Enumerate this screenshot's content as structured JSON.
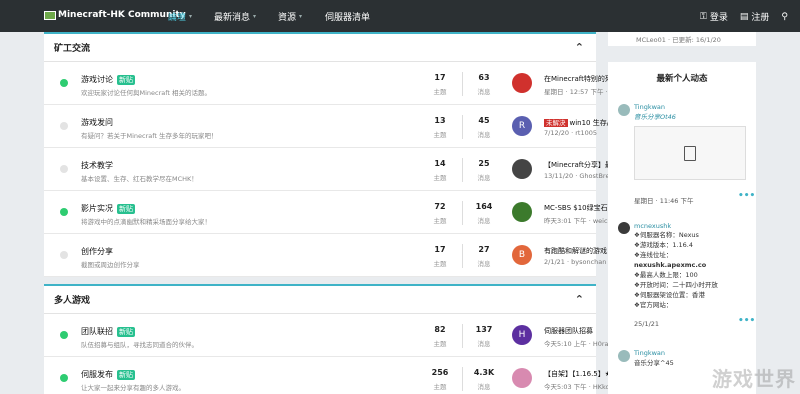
{
  "header": {
    "logo": "Minecraft-HK Community",
    "nav": [
      {
        "label": "論壇",
        "active": true
      },
      {
        "label": "最新消息",
        "active": false
      },
      {
        "label": "資源",
        "active": false
      },
      {
        "label": "伺服器清单",
        "active": false
      }
    ],
    "login": "登录",
    "register": "注册"
  },
  "sections": [
    {
      "title": "矿工交流",
      "rows": [
        {
          "title": "游戏讨论",
          "badge": "新贴",
          "desc": "欢迎玩家讨论任何與Minecraft 相关的话题。",
          "threads": "17",
          "threads_label": "主题",
          "posts": "63",
          "posts_label": "消息",
          "last_title": "在Minecraft特别的死亡...",
          "last_meta": "星期日 · 12:57 下午 · lam...",
          "avatar_letter": "",
          "avatar_color": "#d0312d",
          "active": true
        },
        {
          "title": "游戏发问",
          "badge": "",
          "desc": "有疑问？若关于Minecraft 生存多年的玩家吧！",
          "threads": "13",
          "threads_label": "主题",
          "posts": "45",
          "posts_label": "消息",
          "last_badge": "未解決",
          "last_title": "win10 生存/阿...",
          "last_meta": "7/12/20 · rt1005",
          "avatar_letter": "R",
          "avatar_color": "#5a5fb0",
          "active": false
        },
        {
          "title": "技术教学",
          "badge": "",
          "desc": "基本设置、生存、红石教学尽在MCHK！",
          "threads": "14",
          "threads_label": "主题",
          "posts": "25",
          "posts_label": "消息",
          "last_title": "【Minecraft分享】最新！...",
          "last_meta": "13/11/20 · GhostBread",
          "avatar_letter": "",
          "avatar_color": "#444444",
          "active": false
        },
        {
          "title": "影片实况",
          "badge": "新贴",
          "desc": "将游戏中的点滴幽默和精采场面分享给大家！",
          "threads": "72",
          "threads_label": "主题",
          "posts": "164",
          "posts_label": "消息",
          "last_title": "MC-SBS $10绿宝石活动",
          "last_meta": "昨天3:01 下午 · weichin...",
          "avatar_letter": "",
          "avatar_color": "#3c7a2c",
          "active": true
        },
        {
          "title": "创作分享",
          "badge": "",
          "desc": "截图或周边创作分享",
          "threads": "17",
          "threads_label": "主题",
          "posts": "27",
          "posts_label": "消息",
          "last_title": "有跑酷和解谜的游戏!",
          "last_meta": "2/1/21 · bysonchan",
          "avatar_letter": "B",
          "avatar_color": "#e2673b",
          "active": false
        }
      ]
    },
    {
      "title": "多人游戏",
      "rows": [
        {
          "title": "团队联招",
          "badge": "新贴",
          "desc": "队伍招募与组队，寻找志同道合的伙伴。",
          "threads": "82",
          "threads_label": "主题",
          "posts": "137",
          "posts_label": "消息",
          "last_title": "伺服器团队招募",
          "last_meta": "今天5:10 上午 · H0race...",
          "avatar_letter": "H",
          "avatar_color": "#5c2fa0",
          "active": true
        },
        {
          "title": "伺服发布",
          "badge": "新贴",
          "desc": "让大家一起来分享有趣的多人游戏。",
          "threads": "256",
          "threads_label": "主题",
          "posts": "4.3K",
          "posts_label": "消息",
          "last_title": "【自架】【1.16.5】★偶...",
          "last_meta": "今天5:03 下午 · HKkong...",
          "avatar_letter": "",
          "avatar_color": "#d88ab0",
          "active": true
        }
      ]
    }
  ],
  "sidebar": {
    "top_meta": "MCLeo01 · 已更新: 16/1/20",
    "title": "最新个人动态",
    "posts": [
      {
        "user": "Tingkwan",
        "text": "音乐分享Ot46",
        "time": "星期日 · 11:46 下午"
      },
      {
        "user": "mcnexushk",
        "lines": [
          "❖伺服器名称：Nexus",
          "❖游戏版本：1.16.4",
          "❖连线位址：",
          "nexushk.apexmc.co",
          "❖最高人数上限：100",
          "❖开放时间：二十四小时开放",
          "❖伺服器架设位置：香港",
          "❖官方网站："
        ],
        "time": "25/1/21"
      },
      {
        "user": "Tingkwan",
        "text": "音乐分享^45"
      }
    ]
  },
  "watermark": "游戏世界",
  "colors": {
    "accent": "#3fb3c7",
    "header_bg": "#2b3033",
    "active_dot": "#2ecc71",
    "new_badge": "#27c08f"
  }
}
